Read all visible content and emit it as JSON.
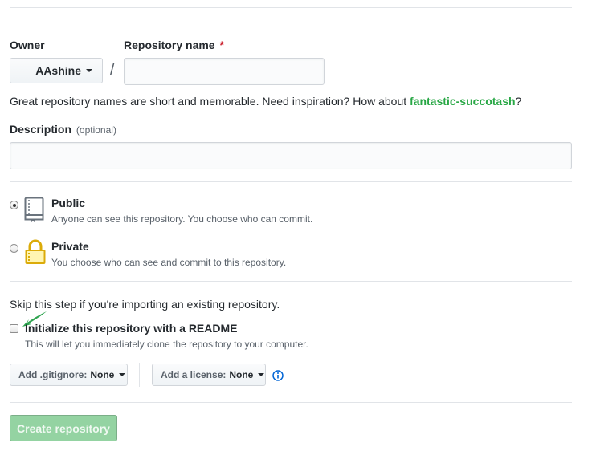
{
  "form": {
    "owner_label": "Owner",
    "owner_value": "AAshine",
    "separator": "/",
    "repo_name_label": "Repository name",
    "required_mark": "*",
    "repo_name_value": "",
    "hint_prefix": "Great repository names are short and memorable. Need inspiration? How about ",
    "hint_suggestion": "fantastic-succotash",
    "hint_suffix": "?",
    "description_label": "Description",
    "description_optional": "(optional)",
    "description_value": ""
  },
  "visibility": {
    "public": {
      "title": "Public",
      "note": "Anyone can see this repository. You choose who can commit.",
      "checked": true
    },
    "private": {
      "title": "Private",
      "note": "You choose who can see and commit to this repository.",
      "checked": false
    }
  },
  "init": {
    "skip_text": "Skip this step if you're importing an existing repository.",
    "readme_label": "Initialize this repository with a README",
    "readme_note": "This will let you immediately clone the repository to your computer.",
    "readme_checked": false
  },
  "options": {
    "gitignore_label": "Add .gitignore:",
    "gitignore_value": "None",
    "license_label": "Add a license:",
    "license_value": "None"
  },
  "actions": {
    "create_label": "Create repository"
  },
  "colors": {
    "suggestion": "#28a745",
    "required": "#cb2431",
    "create_disabled": "#94d3a2",
    "info_icon": "#0366d6",
    "annotation_arrow": "#2ea44f"
  }
}
